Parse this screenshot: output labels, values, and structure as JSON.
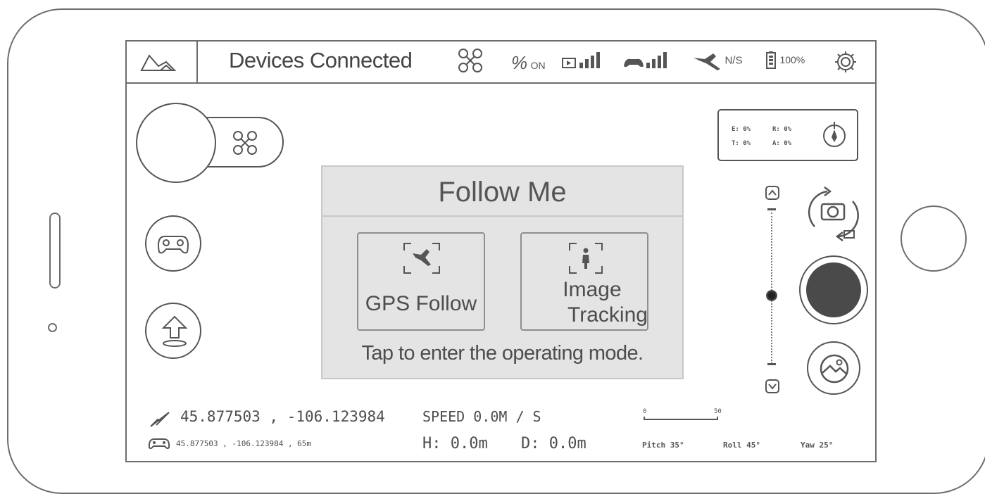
{
  "topbar": {
    "title": "Devices Connected",
    "gps_status": "ON",
    "satellite_status": "N/S",
    "battery": "100%"
  },
  "stick_readout": {
    "e": "E: 0%",
    "r": "R: 0%",
    "t": "T: 0%",
    "a": "A: 0%"
  },
  "follow_me": {
    "title": "Follow Me",
    "gps_follow": "GPS Follow",
    "image_tracking_line1": "Image",
    "image_tracking_line2": "Tracking",
    "hint": "Tap to enter the operating mode."
  },
  "telemetry": {
    "drone_coords": "45.877503 , -106.123984",
    "controller_coords": "45.877503 , -106.123984 , 65m",
    "speed": "SPEED 0.0M / S",
    "height": "H: 0.0m",
    "distance": "D: 0.0m",
    "scale_min": "0",
    "scale_max": "50",
    "pitch": "Pitch 35°",
    "roll": "Roll 45°",
    "yaw": "Yaw 25°"
  },
  "zoom_slider": {
    "level": 0.55
  },
  "colors": {
    "outline": "#6d6d6d",
    "panel_bg": "#e4e4e4",
    "record": "#4a4a4a"
  }
}
